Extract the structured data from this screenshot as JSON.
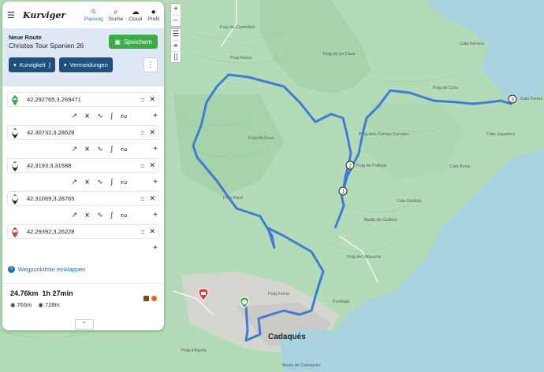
{
  "app": {
    "logo": "Kurviger",
    "nav": [
      {
        "label": "Planung",
        "icon": "map-planning-icon",
        "active": true
      },
      {
        "label": "Suche",
        "icon": "search-icon",
        "active": false
      },
      {
        "label": "Cloud",
        "icon": "cloud-icon",
        "active": false
      },
      {
        "label": "Profil",
        "icon": "user-icon",
        "active": false
      }
    ]
  },
  "route": {
    "kicker": "Neue Route",
    "name": "Christos Tour Spanien 26",
    "save_label": "Speichern",
    "curviness_label": "Kurvigkeit",
    "avoid_label": "Vermeidungen"
  },
  "waypoints": [
    {
      "marker": "",
      "type": "start",
      "coord": "42.292765,3.269471"
    },
    {
      "marker": "1",
      "type": "via",
      "coord": "42.30732,3.28628"
    },
    {
      "marker": "2",
      "type": "via",
      "coord": "42.3193,3.31588"
    },
    {
      "marker": "3",
      "type": "via",
      "coord": "42.31069,3.28765"
    },
    {
      "marker": "",
      "type": "finish",
      "coord": "42.29392,3.26228"
    }
  ],
  "collapse_label": "Wegpunktliste einklappen",
  "summary": {
    "distance": "24.76km",
    "duration": "1h 27min",
    "ascent": "766m",
    "descent": "728m"
  },
  "map_labels": {
    "town": "Cadaqués",
    "places": [
      "Puig de Castellets",
      "Puig Mulus",
      "Puig de sa Casa",
      "Cala Ferrera",
      "Cala Ferriol",
      "Puig de Cutu",
      "Puig Alt Gran",
      "Puig dels Camps Corrales",
      "Puig de Pallejal",
      "Puig Paull",
      "Badia de Guillola",
      "Cala Guillola",
      "Puig de l'Alquería",
      "Puig Ferrai",
      "Portlligat",
      "Puig d'Agulla",
      "Badia de Cadaqués",
      "Cala Bona",
      "Cala Jugadora"
    ]
  },
  "colors": {
    "route": "#3f7cd6",
    "accent": "#1e4f7d",
    "save": "#3dac48",
    "link": "#1d6fb8"
  }
}
